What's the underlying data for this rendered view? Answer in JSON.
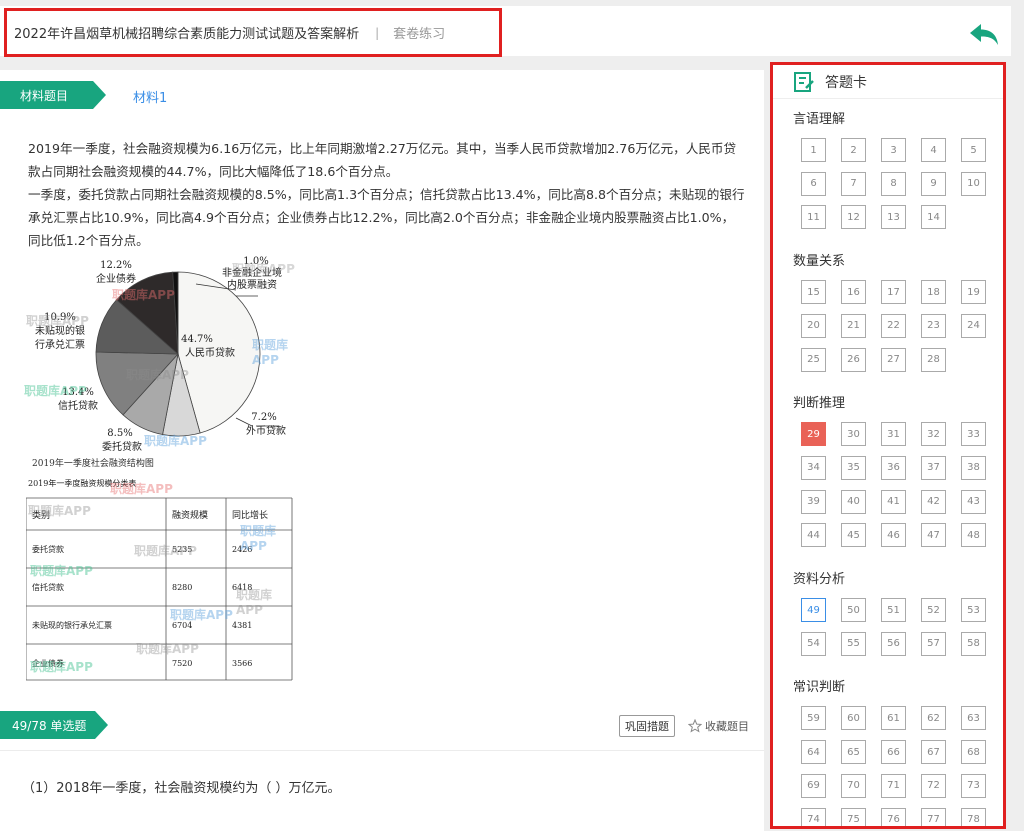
{
  "header": {
    "title": "2022年许昌烟草机械招聘综合素质能力测试试题及答案解析",
    "separator": "|",
    "mode": "套卷练习"
  },
  "material": {
    "tag": "材料题目",
    "link": "材料1",
    "paragraphs": [
      "2019年一季度，社会融资规模为6.16万亿元，比上年同期激增2.27万亿元。其中，当季人民币贷款增加2.76万亿元，人民币贷款占同期社会融资规模的44.7%，同比大幅降低了18.6个百分点。",
      "一季度，委托贷款占同期社会融资规模的8.5%，同比高1.3个百分点；信托贷款占比13.4%，同比高8.8个百分点；未贴现的银行承兑汇票占比10.9%，同比高4.9个百分点；企业债券占比12.2%，同比高2.0个百分点；非金融企业境内股票融资占比1.0%，同比低1.2个百分点。"
    ]
  },
  "chart_data": {
    "type": "pie",
    "title": "2019年一季度社会融资结构图",
    "slices": [
      {
        "label": "人民币贷款",
        "pct_label": "44.7%",
        "value": 44.7,
        "color": "#f6f6f4"
      },
      {
        "label": "外币贷款",
        "pct_label": "7.2%",
        "value": 7.2,
        "color": "#d8d8d8"
      },
      {
        "label": "委托贷款",
        "pct_label": "8.5%",
        "value": 8.5,
        "color": "#a9a9a9"
      },
      {
        "label": "信托贷款",
        "pct_label": "13.4%",
        "value": 13.4,
        "color": "#808080"
      },
      {
        "label": "未贴现的银行承兑汇票",
        "pct_label": "10.9%",
        "value": 10.9,
        "color": "#5c5c5c"
      },
      {
        "label": "企业债券",
        "pct_label": "12.2%",
        "value": 12.2,
        "color": "#2e2a2a"
      },
      {
        "label": "非金融企业境内股票融资",
        "pct_label": "1.0%",
        "value": 1.0,
        "color": "#111111"
      }
    ],
    "label_text": {
      "rmb": [
        "44.7%",
        "人民币贷款"
      ],
      "fx": [
        "7.2%",
        "外币贷款"
      ],
      "entrust": [
        "8.5%",
        "委托贷款"
      ],
      "trust": [
        "13.4%",
        "信托贷款"
      ],
      "bill": [
        "10.9%",
        "未贴现的银",
        "行承兑汇票"
      ],
      "bond": [
        "12.2%",
        "企业债券"
      ],
      "stock": [
        "1.0%",
        "非金融企业境",
        "内股票融资"
      ]
    }
  },
  "table": {
    "title": "2019年一季度融资规模分类表",
    "headers": [
      "类别",
      "融资规模",
      "同比增长"
    ],
    "rows": [
      [
        "委托贷款",
        "5235",
        "2426"
      ],
      [
        "信托贷款",
        "8280",
        "6418"
      ],
      [
        "未贴现的银行承兑汇票",
        "6704",
        "4381"
      ],
      [
        "企业债券",
        "7520",
        "3566"
      ]
    ]
  },
  "watermark": "职题库APP",
  "question": {
    "tag": "49/78 单选题",
    "consolidate_label": "巩固措题",
    "favorite_label": "收藏题目",
    "text": "（1）2018年一季度，社会融资规模约为（      ）万亿元。"
  },
  "answer_card": {
    "title": "答题卡",
    "current": 49,
    "answered": [
      29
    ],
    "sections": [
      {
        "name": "言语理解",
        "start": 1,
        "end": 14
      },
      {
        "name": "数量关系",
        "start": 15,
        "end": 28
      },
      {
        "name": "判断推理",
        "start": 29,
        "end": 48
      },
      {
        "name": "资料分析",
        "start": 49,
        "end": 58
      },
      {
        "name": "常识判断",
        "start": 59,
        "end": 78
      }
    ]
  },
  "colors": {
    "accent_green": "#18a57f",
    "link_blue": "#3a8ee6",
    "answered_red": "#e96257",
    "highlight_border": "#e02020"
  }
}
